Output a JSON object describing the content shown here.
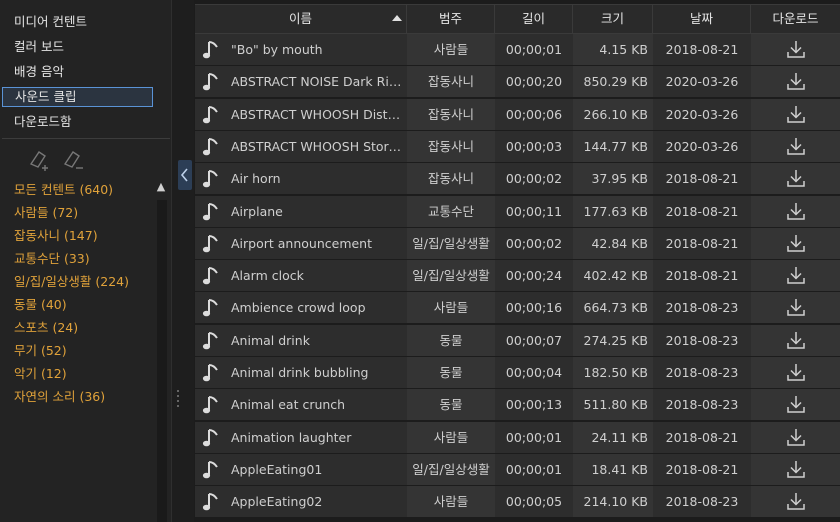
{
  "nav": {
    "items": [
      {
        "label": "미디어 컨텐트"
      },
      {
        "label": "컬러 보드"
      },
      {
        "label": "배경 음악"
      },
      {
        "label": "사운드 클립"
      },
      {
        "label": "다운로드함"
      }
    ],
    "selected_index": 3
  },
  "categories": [
    {
      "label": "모든 컨텐트 (640)"
    },
    {
      "label": "사람들 (72)"
    },
    {
      "label": "잡동사니 (147)"
    },
    {
      "label": "교통수단 (33)"
    },
    {
      "label": "일/집/일상생활 (224)"
    },
    {
      "label": "동물 (40)"
    },
    {
      "label": "스포츠 (24)"
    },
    {
      "label": "무기 (52)"
    },
    {
      "label": "악기 (12)"
    },
    {
      "label": "자연의 소리 (36)"
    }
  ],
  "table": {
    "columns": [
      "이름",
      "범주",
      "길이",
      "크기",
      "날짜",
      "다운로드"
    ],
    "sorted_column": "이름",
    "sort_direction": "ascending",
    "rows": [
      {
        "name": "\"Bo\" by mouth",
        "category": "사람들",
        "length": "00;00;01",
        "size": "4.15 KB",
        "date": "2018-08-21"
      },
      {
        "name": "ABSTRACT NOISE Dark Risin...",
        "category": "잡동사니",
        "length": "00;00;20",
        "size": "850.29 KB",
        "date": "2020-03-26"
      },
      {
        "name": "ABSTRACT WHOOSH Distort...",
        "category": "잡동사니",
        "length": "00;00;06",
        "size": "266.10 KB",
        "date": "2020-03-26"
      },
      {
        "name": "ABSTRACT WHOOSH Storm ...",
        "category": "잡동사니",
        "length": "00;00;03",
        "size": "144.77 KB",
        "date": "2020-03-26"
      },
      {
        "name": "Air horn",
        "category": "잡동사니",
        "length": "00;00;02",
        "size": "37.95 KB",
        "date": "2018-08-21"
      },
      {
        "name": "Airplane",
        "category": "교통수단",
        "length": "00;00;11",
        "size": "177.63 KB",
        "date": "2018-08-21"
      },
      {
        "name": "Airport announcement",
        "category": "일/집/일상생활",
        "length": "00;00;02",
        "size": "42.84 KB",
        "date": "2018-08-21"
      },
      {
        "name": "Alarm clock",
        "category": "일/집/일상생활",
        "length": "00;00;24",
        "size": "402.42 KB",
        "date": "2018-08-21"
      },
      {
        "name": "Ambience crowd loop",
        "category": "사람들",
        "length": "00;00;16",
        "size": "664.73 KB",
        "date": "2018-08-23"
      },
      {
        "name": "Animal drink",
        "category": "동물",
        "length": "00;00;07",
        "size": "274.25 KB",
        "date": "2018-08-23"
      },
      {
        "name": "Animal drink bubbling",
        "category": "동물",
        "length": "00;00;04",
        "size": "182.50 KB",
        "date": "2018-08-23"
      },
      {
        "name": "Animal eat crunch",
        "category": "동물",
        "length": "00;00;13",
        "size": "511.80 KB",
        "date": "2018-08-23"
      },
      {
        "name": "Animation laughter",
        "category": "사람들",
        "length": "00;00;01",
        "size": "24.11 KB",
        "date": "2018-08-21"
      },
      {
        "name": "AppleEating01",
        "category": "일/집/일상생활",
        "length": "00;00;01",
        "size": "18.41 KB",
        "date": "2018-08-21"
      },
      {
        "name": "AppleEating02",
        "category": "사람들",
        "length": "00;00;05",
        "size": "214.10 KB",
        "date": "2018-08-23"
      }
    ]
  },
  "icons": {
    "row_icon": "music-note-icon",
    "download_icon": "download-icon",
    "tag_add": "tag-add-icon",
    "tag_remove": "tag-remove-icon",
    "collapse": "chevron-left-icon"
  },
  "colors": {
    "category_text": "#e0a23a",
    "selection_border": "#5a93d6"
  }
}
